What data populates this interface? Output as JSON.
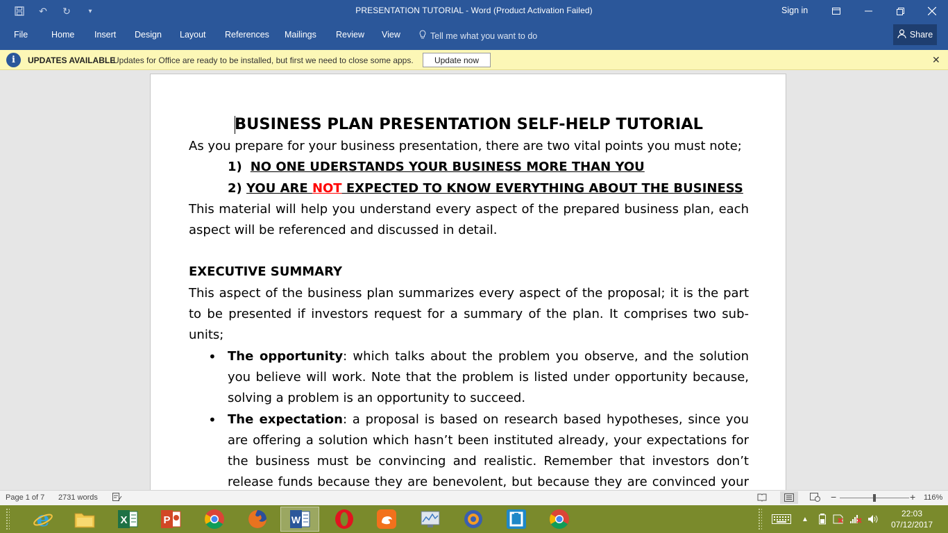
{
  "window": {
    "title": "PRESENTATION TUTORIAL  -  Word (Product Activation Failed)",
    "sign_in": "Sign in"
  },
  "ribbon": {
    "tabs": [
      {
        "label": "File"
      },
      {
        "label": "Home"
      },
      {
        "label": "Insert"
      },
      {
        "label": "Design"
      },
      {
        "label": "Layout"
      },
      {
        "label": "References"
      },
      {
        "label": "Mailings"
      },
      {
        "label": "Review"
      },
      {
        "label": "View"
      }
    ],
    "tell_me": "Tell me what you want to do",
    "share": "Share"
  },
  "message_bar": {
    "title": "UPDATES AVAILABLE",
    "text": "Updates for Office are ready to be installed, but first we need to close some apps.",
    "button": "Update now"
  },
  "document": {
    "title": "BUSINESS PLAN PRESENTATION SELF-HELP TUTORIAL",
    "intro": "As you prepare for your business presentation, there are two vital points you must note;",
    "points": [
      {
        "num": "1)",
        "text": "NO ONE UDERSTANDS YOUR BUSINESS MORE THAN YOU"
      },
      {
        "num": "2)",
        "before": "YOU ARE ",
        "highlight": "NOT",
        "after": " EXPECTED TO KNOW EVERYTHING ABOUT THE BUSINESS"
      }
    ],
    "material": "This material will help you understand every aspect of the prepared business plan, each aspect will be referenced and discussed in detail.",
    "heading": "EXECUTIVE SUMMARY",
    "summary": "This aspect of the business plan summarizes every aspect of the proposal; it is the part to be presented if investors request for a summary of the plan. It comprises two sub-units;",
    "bullets": [
      {
        "term": "The opportunity",
        "text": ": which talks about the problem you observe, and the solution you believe will work. Note that the problem is listed under opportunity because, solving a problem is an opportunity to succeed."
      },
      {
        "term": "The expectation",
        "text": ": a proposal is based on research based hypotheses, since you are offering a solution which hasn’t been instituted already, your expectations for the business must be convincing and realistic. Remember that investors don’t release funds because they are benevolent, but because they are convinced your plan will work."
      }
    ]
  },
  "status_bar": {
    "page": "Page 1 of 7",
    "words": "2731 words",
    "zoom": "116%"
  },
  "clock": {
    "time": "22:03",
    "date": "07/12/2017"
  },
  "colors": {
    "ribbon": "#2b579a",
    "message_bar": "#fcf7b6",
    "taskbar": "#7a8a2c",
    "emphasis_red": "#ff0000"
  }
}
